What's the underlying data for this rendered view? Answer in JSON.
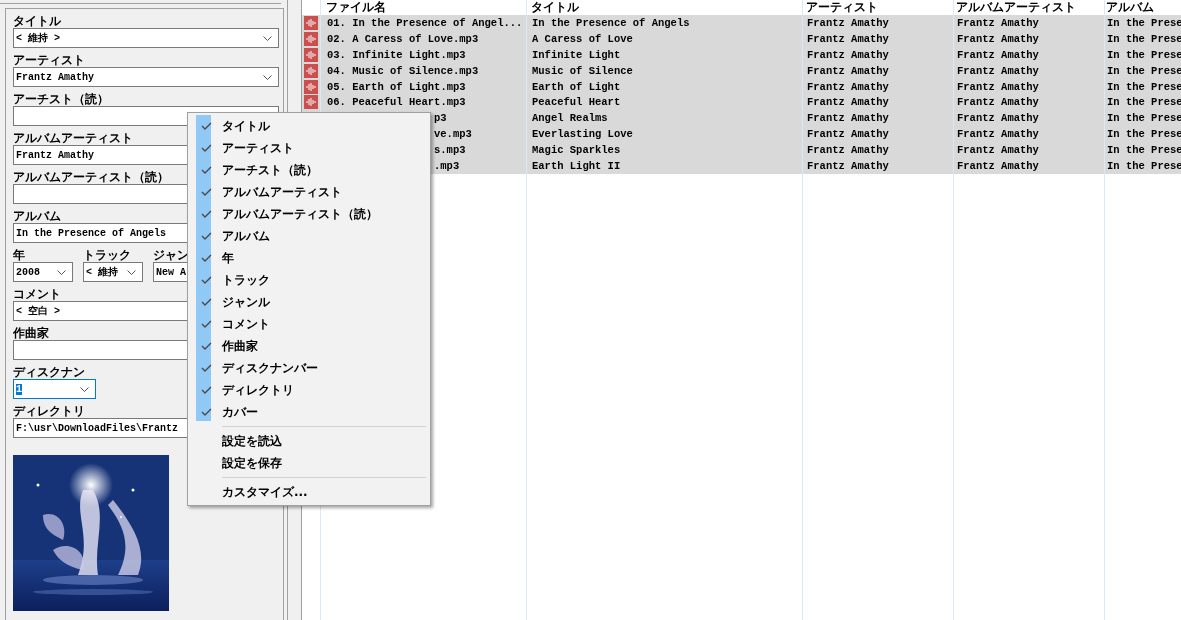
{
  "editor": {
    "fields": [
      {
        "label": "タイトル",
        "kind": "combo",
        "value": "< 維持 >"
      },
      {
        "label": "アーティスト",
        "kind": "combo",
        "value": "Frantz Amathy"
      },
      {
        "label": "アーチスト（読）",
        "kind": "text"
      },
      {
        "label": "アルバムアーティスト",
        "kind": "text",
        "value": "Frantz Amathy"
      },
      {
        "label": "アルバムアーティスト（読）",
        "kind": "text"
      },
      {
        "label": "アルバム",
        "kind": "text",
        "value": "In the Presence of Angels"
      }
    ],
    "row_fields": [
      {
        "label": "年",
        "kind": "combo",
        "value": "2008"
      },
      {
        "label": "トラック",
        "kind": "combo",
        "value": "< 維持"
      },
      {
        "label": "ジャン",
        "kind": "text",
        "value": "New A"
      }
    ],
    "fields2": [
      {
        "label": "コメント",
        "kind": "text",
        "value": "< 空白 >"
      },
      {
        "label": "作曲家",
        "kind": "text"
      },
      {
        "label": "ディスクナン",
        "kind": "focused",
        "value": "1"
      },
      {
        "label": "ディレクトリ",
        "kind": "text",
        "value": "F:\\usr\\DownloadFiles\\Frantz"
      }
    ]
  },
  "table": {
    "columns": [
      "ファイル名",
      "タイトル",
      "アーティスト",
      "アルバムアーティスト",
      "アルバム"
    ],
    "rows": [
      {
        "kind": "full",
        "cells": [
          "01. In the Presence of Angel...",
          "In the Presence of Angels",
          "Frantz Amathy",
          "Frantz Amathy",
          "In the Prese"
        ]
      },
      {
        "kind": "full",
        "cells": [
          "02. A Caress of Love.mp3",
          "A Caress of Love",
          "Frantz Amathy",
          "Frantz Amathy",
          "In the Prese"
        ]
      },
      {
        "kind": "full",
        "cells": [
          "03. Infinite Light.mp3",
          "Infinite Light",
          "Frantz Amathy",
          "Frantz Amathy",
          "In the Prese"
        ]
      },
      {
        "kind": "full",
        "cells": [
          "04. Music of Silence.mp3",
          "Music of Silence",
          "Frantz Amathy",
          "Frantz Amathy",
          "In the Prese"
        ]
      },
      {
        "kind": "full",
        "cells": [
          "05. Earth of Light.mp3",
          "Earth of Light",
          "Frantz Amathy",
          "Frantz Amathy",
          "In the Prese"
        ]
      },
      {
        "kind": "full",
        "cells": [
          "06. Peaceful Heart.mp3",
          "Peaceful Heart",
          "Frantz Amathy",
          "Frantz Amathy",
          "In the Prese"
        ]
      },
      {
        "kind": "partial",
        "cells": [
          "p3",
          "Angel Realms",
          "Frantz Amathy",
          "Frantz Amathy",
          "In the Prese"
        ]
      },
      {
        "kind": "partial",
        "cells": [
          "ve.mp3",
          "Everlasting Love",
          "Frantz Amathy",
          "Frantz Amathy",
          "In the Prese"
        ]
      },
      {
        "kind": "partial",
        "cells": [
          "s.mp3",
          "Magic Sparkles",
          "Frantz Amathy",
          "Frantz Amathy",
          "In the Prese"
        ]
      },
      {
        "kind": "partial",
        "cells": [
          ".mp3",
          "Earth Light II",
          "Frantz Amathy",
          "Frantz Amathy",
          "In the Prese"
        ]
      }
    ]
  },
  "context_menu": {
    "groups": [
      [
        {
          "label": "タイトル",
          "checked": true
        },
        {
          "label": "アーティスト",
          "checked": true
        },
        {
          "label": "アーチスト（読）",
          "checked": true
        },
        {
          "label": "アルバムアーティスト",
          "checked": true
        },
        {
          "label": "アルバムアーティスト（読）",
          "checked": true
        },
        {
          "label": "アルバム",
          "checked": true
        },
        {
          "label": "年",
          "checked": true
        },
        {
          "label": "トラック",
          "checked": true
        },
        {
          "label": "ジャンル",
          "checked": true
        },
        {
          "label": "コメント",
          "checked": true
        },
        {
          "label": "作曲家",
          "checked": true
        },
        {
          "label": "ディスクナンバー",
          "checked": true
        },
        {
          "label": "ディレクトリ",
          "checked": true
        },
        {
          "label": "カバー",
          "checked": true
        }
      ],
      [
        {
          "label": "設定を読込",
          "checked": false
        },
        {
          "label": "設定を保存",
          "checked": false
        }
      ],
      [
        {
          "label": "カスタマイズ...",
          "checked": false
        }
      ]
    ]
  }
}
